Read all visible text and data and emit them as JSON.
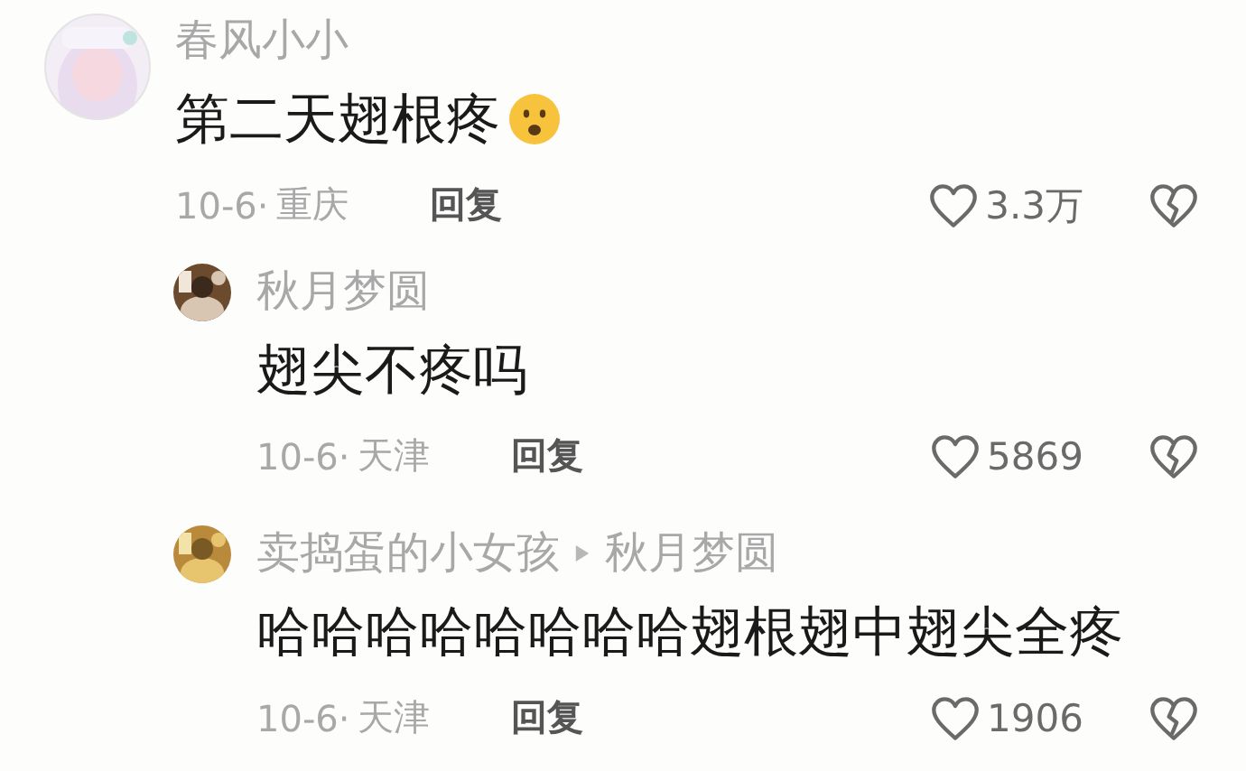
{
  "comments": [
    {
      "author": "春风小小",
      "text": "第二天翅根疼",
      "emoji": true,
      "date": "10-6·",
      "location": "重庆",
      "reply_label": "回复",
      "likes": "3.3万",
      "children": [
        {
          "author": "秋月梦圆",
          "text": "翅尖不疼吗",
          "date": "10-6·",
          "location": "天津",
          "reply_label": "回复",
          "likes": "5869"
        },
        {
          "author": "卖捣蛋的小女孩",
          "reply_to": "秋月梦圆",
          "text": "哈哈哈哈哈哈哈哈翅根翅中翅尖全疼",
          "date": "10-6·",
          "location": "天津",
          "reply_label": "回复",
          "likes": "1906"
        }
      ]
    }
  ]
}
